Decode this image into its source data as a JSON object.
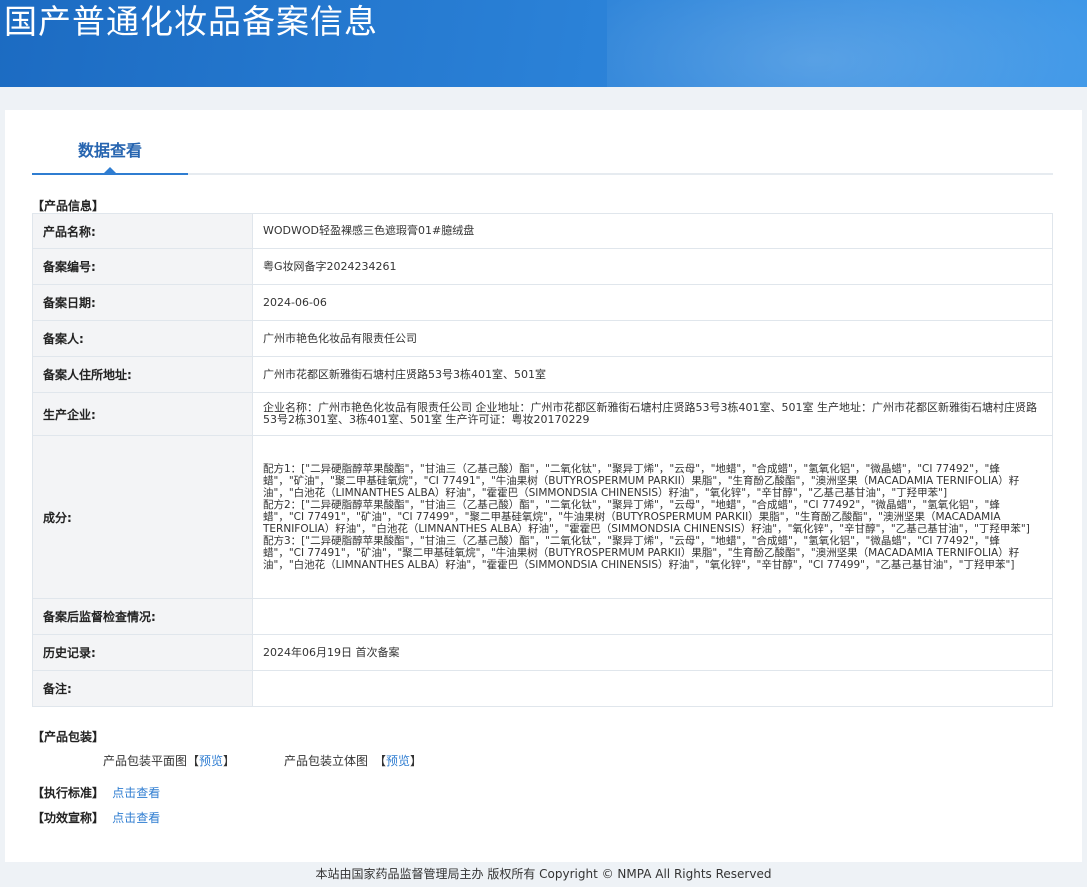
{
  "site_title": "国产普通化妆品备案信息",
  "tab_label": "数据查看",
  "section_product_info": "【产品信息】",
  "fields": [
    {
      "label": "产品名称:",
      "value": "WODWOD轻盈裸感三色遮瑕膏01#臆绒盘"
    },
    {
      "label": "备案编号:",
      "value": "粤G妆网备字2024234261"
    },
    {
      "label": "备案日期:",
      "value": "2024-06-06"
    },
    {
      "label": "备案人:",
      "value": "广州市艳色化妆品有限责任公司"
    },
    {
      "label": "备案人住所地址:",
      "value": "广州市花都区新雅街石塘村庄贤路53号3栋401室、501室"
    },
    {
      "label": "生产企业:",
      "value": "企业名称：广州市艳色化妆品有限责任公司 企业地址：广州市花都区新雅街石塘村庄贤路53号3栋401室、501室 生产地址：广州市花都区新雅街石塘村庄贤路53号2栋301室、3栋401室、501室 生产许可证：粤妆20170229"
    },
    {
      "label": "成分:",
      "formulas": [
        "配方1：[\"二异硬脂醇苹果酸酯\"，\"甘油三（乙基己酸）酯\"，\"二氧化钛\"，\"聚异丁烯\"，\"云母\"，\"地蜡\"，\"合成蜡\"，\"氢氧化铝\"，\"微晶蜡\"，\"CI 77492\"，\"蜂蜡\"，\"矿油\"，\"聚二甲基硅氧烷\"，\"CI 77491\"，\"牛油果树（BUTYROSPERMUM PARKII）果脂\"，\"生育酚乙酸酯\"，\"澳洲坚果（MACADAMIA TERNIFOLIA）籽油\"，\"白池花（LIMNANTHES ALBA）籽油\"，\"霍霍巴（SIMMONDSIA CHINENSIS）籽油\"，\"氧化锌\"，\"辛甘醇\"，\"乙基己基甘油\"，\"丁羟甲苯\"]",
        "配方2：[\"二异硬脂醇苹果酸酯\"，\"甘油三（乙基己酸）酯\"，\"二氧化钛\"，\"聚异丁烯\"，\"云母\"，\"地蜡\"，\"合成蜡\"，\"CI 77492\"，\"微晶蜡\"，\"氢氧化铝\"，\"蜂蜡\"，\"CI 77491\"，\"矿油\"，\"CI 77499\"，\"聚二甲基硅氧烷\"，\"牛油果树（BUTYROSPERMUM PARKII）果脂\"，\"生育酚乙酸酯\"，\"澳洲坚果（MACADAMIA TERNIFOLIA）籽油\"，\"白池花（LIMNANTHES ALBA）籽油\"，\"霍霍巴（SIMMONDSIA CHINENSIS）籽油\"，\"氧化锌\"，\"辛甘醇\"，\"乙基己基甘油\"，\"丁羟甲苯\"]",
        "配方3：[\"二异硬脂醇苹果酸酯\"，\"甘油三（乙基己酸）酯\"，\"二氧化钛\"，\"聚异丁烯\"，\"云母\"，\"地蜡\"，\"合成蜡\"，\"氢氧化铝\"，\"微晶蜡\"，\"CI 77492\"，\"蜂蜡\"，\"CI 77491\"，\"矿油\"，\"聚二甲基硅氧烷\"，\"牛油果树（BUTYROSPERMUM PARKII）果脂\"，\"生育酚乙酸酯\"，\"澳洲坚果（MACADAMIA TERNIFOLIA）籽油\"，\"白池花（LIMNANTHES ALBA）籽油\"，\"霍霍巴（SIMMONDSIA CHINENSIS）籽油\"，\"氧化锌\"，\"辛甘醇\"，\"CI 77499\"，\"乙基己基甘油\"，\"丁羟甲苯\"]"
      ]
    },
    {
      "label": "备案后监督检查情况:",
      "value": ""
    },
    {
      "label": "历史记录:",
      "value": "2024年06月19日 首次备案"
    },
    {
      "label": "备注:",
      "value": ""
    }
  ],
  "section_packaging": "【产品包装】",
  "packaging": {
    "flat_label": "产品包装平面图",
    "flat_open": "【",
    "flat_link": "预览",
    "flat_close": "】",
    "solid_label": "产品包装立体图",
    "solid_open": "【",
    "solid_link": "预览",
    "solid_close": "】"
  },
  "section_standard": "【执行标准】",
  "standard_link": "点击查看",
  "section_efficacy": "【功效宣称】",
  "efficacy_link": "点击查看",
  "footer_text": "本站由国家药品监督管理局主办 版权所有 Copyright © NMPA All Rights Reserved"
}
